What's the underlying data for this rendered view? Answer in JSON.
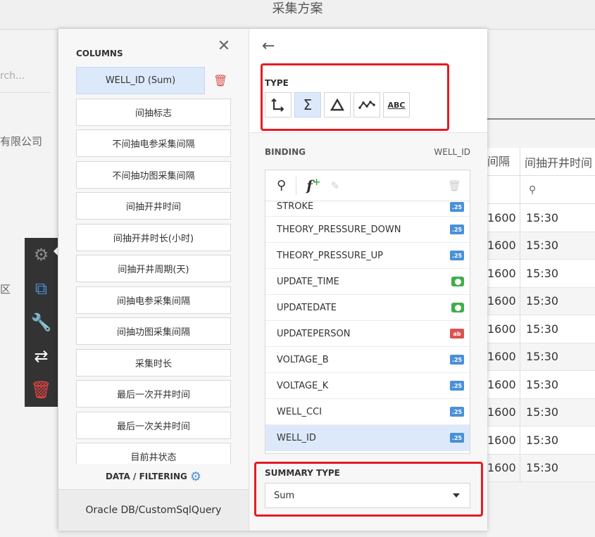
{
  "background": {
    "title": "采集方案",
    "search_placeholder": "rch...",
    "company": "有限公司",
    "area": "区",
    "table": {
      "headers": [
        "间隔",
        "间抽开井时间"
      ],
      "filter_icon": "search-icon",
      "rows": [
        [
          "1600",
          "15:30"
        ],
        [
          "1600",
          "15:30"
        ],
        [
          "1600",
          "15:30"
        ],
        [
          "1600",
          "15:30"
        ],
        [
          "1600",
          "15:30"
        ],
        [
          "1600",
          "15:30"
        ],
        [
          "1600",
          "15:30"
        ],
        [
          "1600",
          "15:30"
        ],
        [
          "1600",
          "15:30"
        ],
        [
          "1600",
          "15:30"
        ]
      ]
    }
  },
  "side_toolbar": {
    "items": [
      {
        "icon": "gear-icon",
        "glyph": "⚙"
      },
      {
        "icon": "convert-icon",
        "glyph": "⧉"
      },
      {
        "icon": "wrench-icon",
        "glyph": "🔧"
      },
      {
        "icon": "swap-icon",
        "glyph": "⇄"
      },
      {
        "icon": "trash-icon",
        "glyph": "🗑"
      }
    ]
  },
  "columns": {
    "header": "COLUMNS",
    "close_glyph": "✕",
    "items": [
      "WELL_ID (Sum)",
      "间抽标志",
      "不间抽电参采集间隔",
      "不间抽功图采集间隔",
      "间抽开井时间",
      "间抽开井时长(小时)",
      "间抽开井周期(天)",
      "间抽电参采集间隔",
      "间抽功图采集间隔",
      "采集时长",
      "最后一次开井时间",
      "最后一次关井时间",
      "目前井状态"
    ],
    "data_filtering": "DATA / FILTERING",
    "source": "Oracle DB/CustomSqlQuery"
  },
  "options": {
    "back_glyph": "←",
    "type_label": "TYPE",
    "types": [
      {
        "name": "dimension",
        "glyph": "⮤"
      },
      {
        "name": "measure",
        "glyph": "Σ"
      },
      {
        "name": "delta",
        "glyph": "▲"
      },
      {
        "name": "sparkline",
        "glyph": "∿"
      },
      {
        "name": "text",
        "glyph": "ABC"
      }
    ],
    "binding_label": "BINDING",
    "binding_value": "WELL_ID",
    "binding_items": [
      {
        "name": "STROKE",
        "type": "num",
        "badge": ".25"
      },
      {
        "name": "THEORY_PRESSURE_DOWN",
        "type": "num",
        "badge": ".25"
      },
      {
        "name": "THEORY_PRESSURE_UP",
        "type": "num",
        "badge": ".25"
      },
      {
        "name": "UPDATE_TIME",
        "type": "date",
        "badge": ""
      },
      {
        "name": "UPDATEDATE",
        "type": "date",
        "badge": ""
      },
      {
        "name": "UPDATEPERSON",
        "type": "str",
        "badge": "ab"
      },
      {
        "name": "VOLTAGE_B",
        "type": "num",
        "badge": ".25"
      },
      {
        "name": "VOLTAGE_K",
        "type": "num",
        "badge": ".25"
      },
      {
        "name": "WELL_CCI",
        "type": "num",
        "badge": ".25"
      },
      {
        "name": "WELL_ID",
        "type": "num",
        "badge": ".25"
      }
    ],
    "summary_label": "SUMMARY TYPE",
    "summary_value": "Sum"
  },
  "colors": {
    "highlight": "#e51c23",
    "selected": "#dce9fa",
    "accent": "#4a90d9"
  }
}
